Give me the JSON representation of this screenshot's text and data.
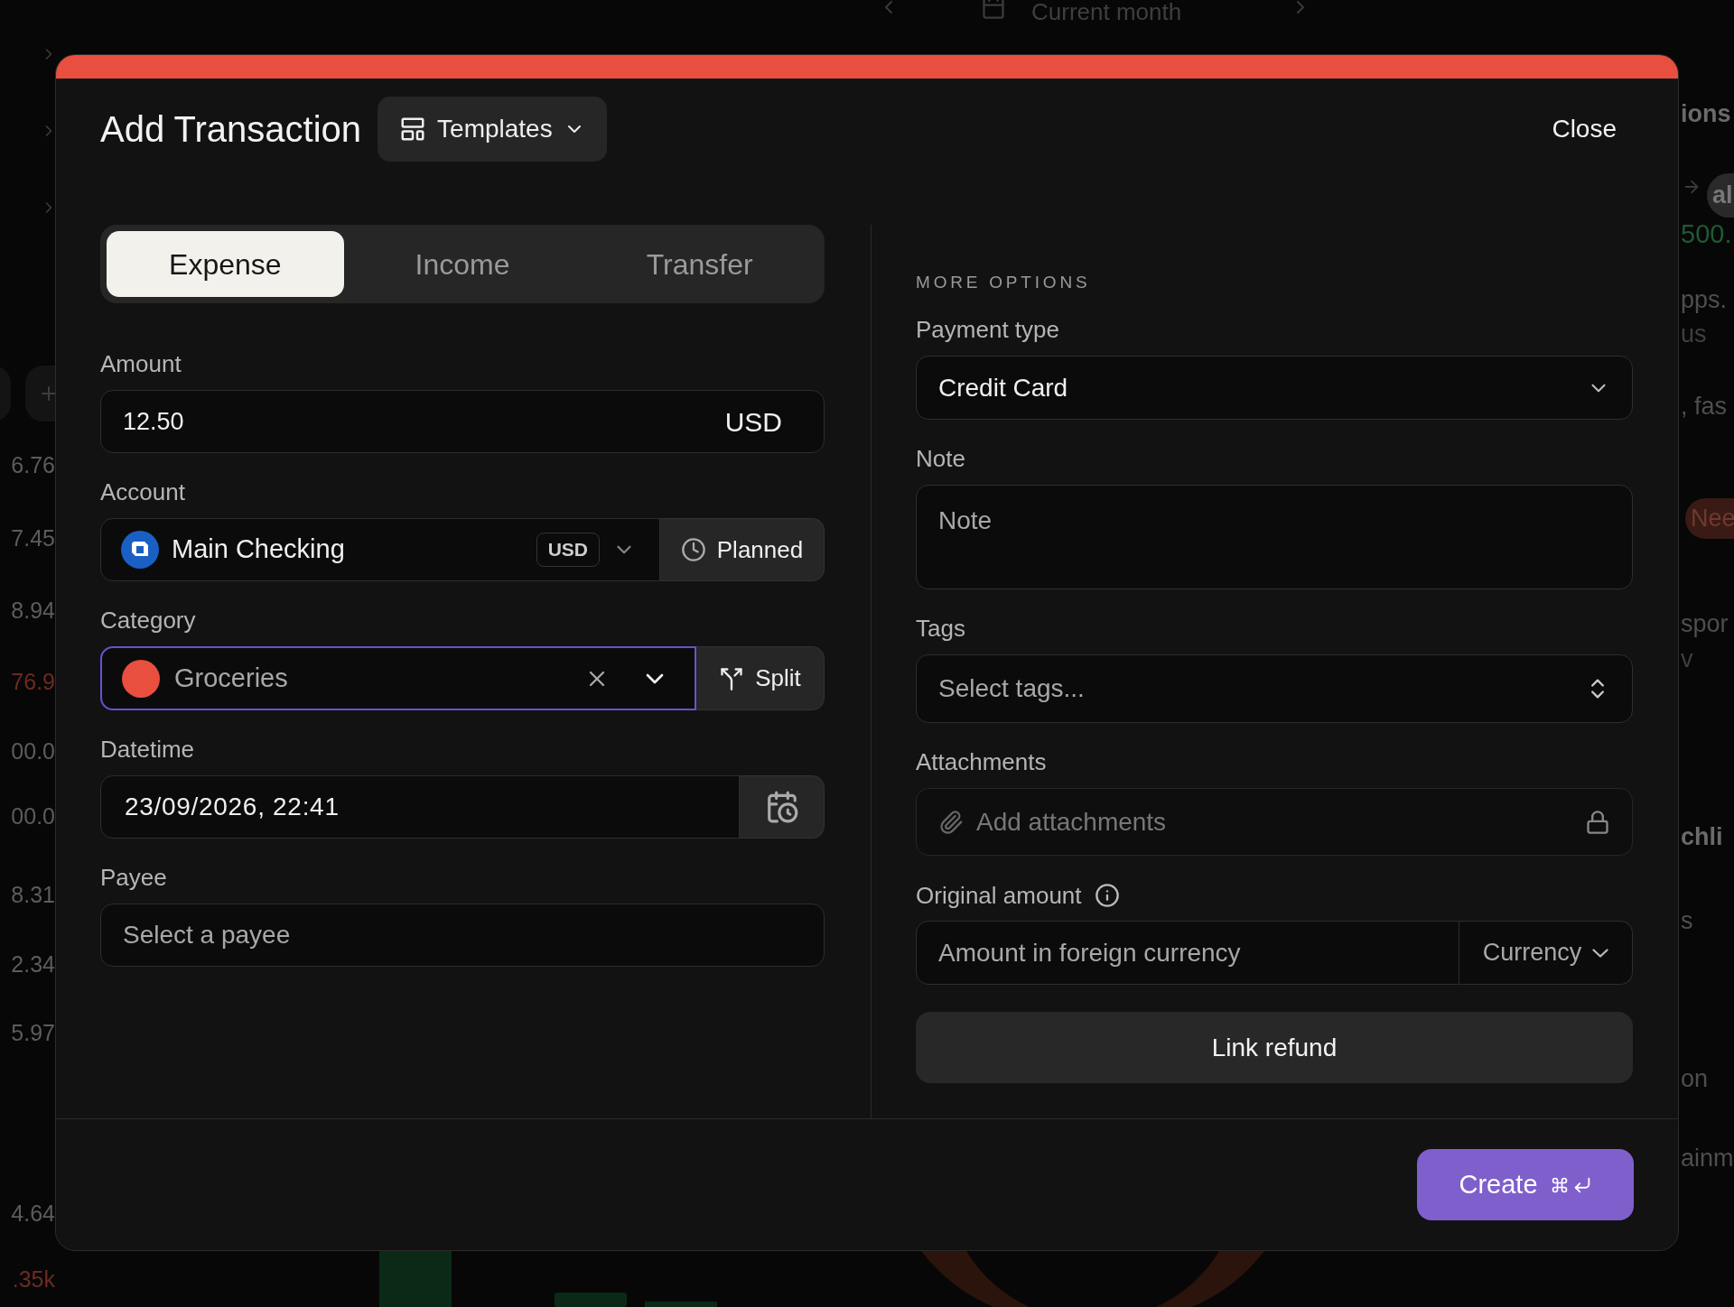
{
  "backdrop": {
    "period_label": "Current month",
    "left_values": [
      {
        "text": "6.76",
        "color": "#5c5c5c"
      },
      {
        "text": "7.45",
        "color": "#5c5c5c"
      },
      {
        "text": "8.94",
        "color": "#5c5c5c"
      },
      {
        "text": "76.9",
        "color": "#6e2a20"
      },
      {
        "text": "00.0",
        "color": "#5c5c5c"
      },
      {
        "text": "00.0",
        "color": "#5c5c5c"
      },
      {
        "text": "8.31",
        "color": "#5c5c5c"
      },
      {
        "text": "2.34",
        "color": "#5c5c5c"
      },
      {
        "text": "5.97",
        "color": "#5c5c5c"
      },
      {
        "text": "4.64",
        "color": "#5c5c5c"
      },
      {
        "text": ".35k",
        "color": "#6e2a20"
      }
    ],
    "right_fragments": [
      {
        "text": "ions",
        "kind": "heading"
      },
      {
        "text": "al",
        "kind": "logo"
      },
      {
        "text": "500.",
        "kind": "amount"
      },
      {
        "text": "pps.",
        "kind": "text"
      },
      {
        "text": "us",
        "kind": "muted"
      },
      {
        "text": ", fas",
        "kind": "text"
      },
      {
        "text": "Nee",
        "kind": "tag"
      },
      {
        "text": "spor",
        "kind": "text"
      },
      {
        "text": "v",
        "kind": "muted"
      },
      {
        "text": "chli",
        "kind": "heading"
      },
      {
        "text": "s",
        "kind": "text"
      },
      {
        "text": "on",
        "kind": "text"
      },
      {
        "text": "ainm",
        "kind": "text"
      }
    ]
  },
  "dialog": {
    "title": "Add Transaction",
    "templates_button": "Templates",
    "close_button": "Close",
    "tabs": [
      {
        "label": "Expense",
        "selected": true
      },
      {
        "label": "Income",
        "selected": false
      },
      {
        "label": "Transfer",
        "selected": false
      }
    ],
    "amount": {
      "label": "Amount",
      "value": "12.50",
      "currency": "USD"
    },
    "account": {
      "label": "Account",
      "value": "Main Checking",
      "currency": "USD",
      "planned_button": "Planned"
    },
    "category": {
      "label": "Category",
      "value": "Groceries",
      "color": "#e84f3f",
      "focused": true,
      "split_button": "Split"
    },
    "datetime": {
      "label": "Datetime",
      "value": "23/09/2026, 22:41"
    },
    "payee": {
      "label": "Payee",
      "placeholder": "Select a payee"
    },
    "more_options": {
      "heading": "MORE OPTIONS",
      "payment_type": {
        "label": "Payment type",
        "value": "Credit Card"
      },
      "note": {
        "label": "Note",
        "placeholder": "Note"
      },
      "tags": {
        "label": "Tags",
        "placeholder": "Select tags..."
      },
      "attachments": {
        "label": "Attachments",
        "placeholder": "Add attachments",
        "locked": true
      },
      "original_amount": {
        "label": "Original amount",
        "placeholder": "Amount in foreign currency",
        "currency_placeholder": "Currency"
      },
      "link_refund_button": "Link refund"
    },
    "create_button": "Create"
  }
}
